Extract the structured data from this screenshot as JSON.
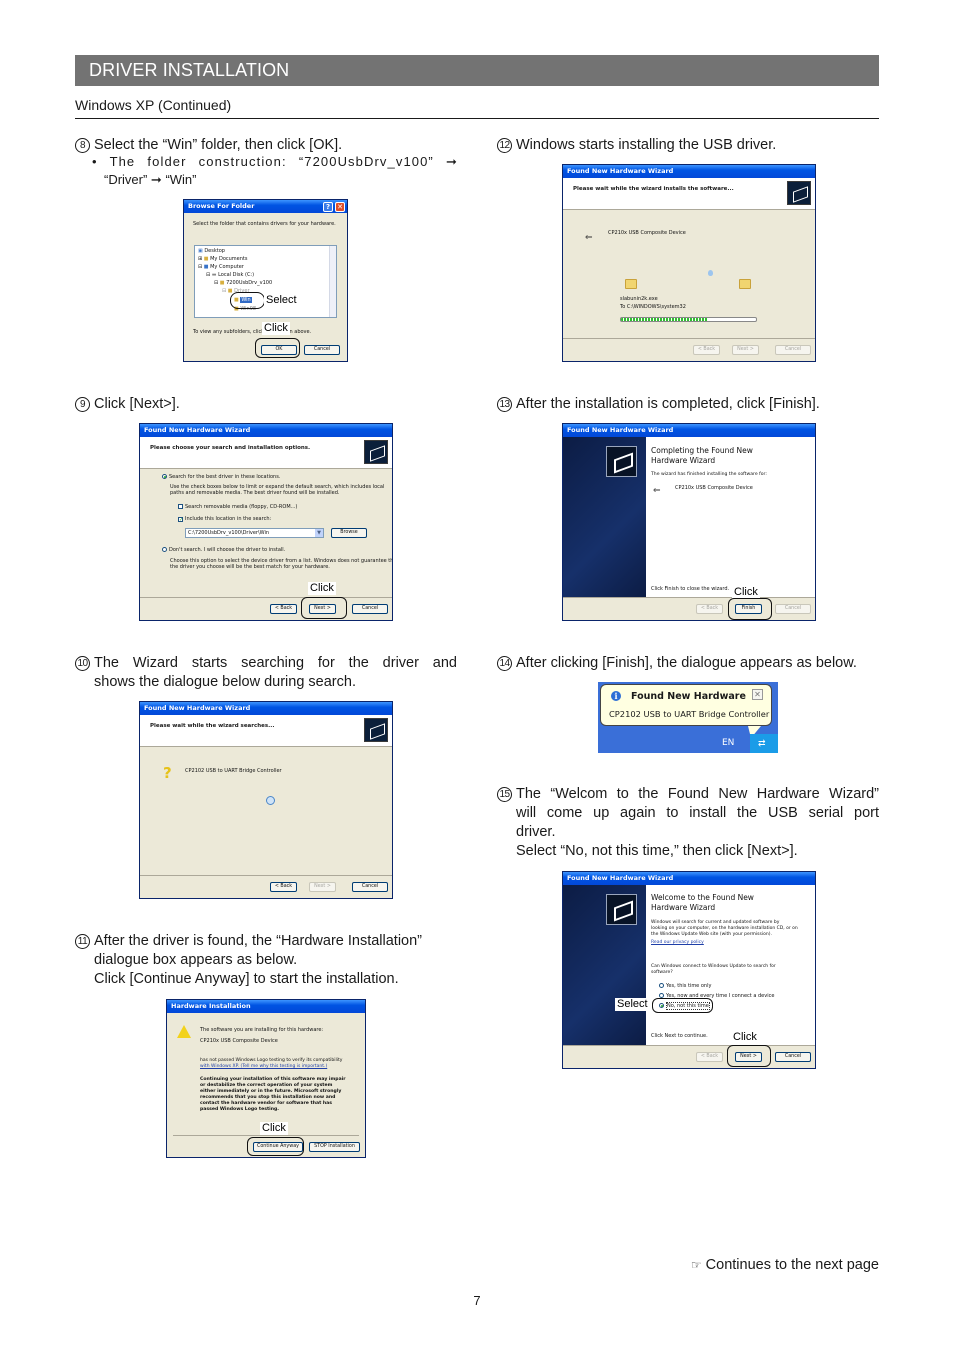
{
  "header": {
    "banner_title": "DRIVER INSTALLATION",
    "section_title": "Windows XP (Continued)"
  },
  "steps": [
    {
      "num": "8",
      "lines": [
        "Select the “Win” folder, then click [OK]."
      ],
      "bullet": [
        "• The folder construction: “7200UsbDrv_v100” ➞",
        "“Driver” ➞ “Win”"
      ],
      "dialog": {
        "title": "Browse For Folder",
        "prompt": "Select the folder that contains drivers for your hardware.",
        "tree": [
          "Desktop",
          "My Documents",
          "My Computer",
          "Local Disk (C:)",
          "7200UsbDrv_v100",
          "Driver",
          "Win",
          "Win98"
        ],
        "hint": "To view any subfolders, click a plus sign above.",
        "ok": "OK",
        "cancel": "Cancel",
        "callout_select": "Select",
        "callout_click": "Click"
      }
    },
    {
      "num": "9",
      "lines": [
        "Click [Next>]."
      ],
      "dialog": {
        "title": "Found New Hardware Wizard",
        "header": "Please choose your search and installation options.",
        "opt1": "Search for the best driver in these locations.",
        "opt1_desc": [
          "Use the check boxes below to limit or expand the default search, which includes local",
          "paths and removable media. The best driver found will be installed."
        ],
        "chk1": "Search removable media (floppy, CD-ROM...)",
        "chk2": "Include this location in the search:",
        "path": "C:\\7200UsbDrv_v100\\Driver\\Win",
        "browse": "Browse",
        "opt2": "Don't search. I will choose the driver to install.",
        "opt2_desc": [
          "Choose this option to select the device driver from a list.  Windows does not guarantee that",
          "the driver you choose will be the best match for your hardware."
        ],
        "back": "< Back",
        "next": "Next >",
        "cancel": "Cancel",
        "callout_click": "Click"
      }
    },
    {
      "num": "10",
      "lines": [
        "The Wizard starts searching for the driver and",
        "shows the dialogue below during search."
      ],
      "dialog": {
        "title": "Found New Hardware Wizard",
        "header": "Please wait while the wizard searches...",
        "device": "CP2102 USB to UART Bridge Controller",
        "back": "< Back",
        "next": "Next >",
        "cancel": "Cancel"
      }
    },
    {
      "num": "11",
      "lines": [
        "After the driver is found, the “Hardware Installation”",
        "dialogue box appears as below.",
        "Click [Continue Anyway] to start the installation."
      ],
      "dialog": {
        "title": "Hardware Installation",
        "line1": "The software you are installing for this hardware:",
        "device": "CP210x USB Composite Device",
        "line2": [
          "has not passed Windows Logo testing to verify its compatibility",
          "with Windows XP. (Tell me why this testing is important.)"
        ],
        "warning": [
          "Continuing your installation of this software may impair",
          "or destabilize the correct operation of your system",
          "either immediately or in the future. Microsoft strongly",
          "recommends that you stop this installation now and",
          "contact the hardware vendor for software that has",
          "passed Windows Logo testing."
        ],
        "continue": "Continue Anyway",
        "stop": "STOP Installation",
        "callout_click": "Click"
      }
    },
    {
      "num": "12",
      "lines": [
        "Windows starts installing the USB driver."
      ],
      "dialog": {
        "title": "Found New Hardware Wizard",
        "header": "Please wait while the wizard installs the software...",
        "device": "CP210x USB Composite Device",
        "file": "slabunin2k.exe",
        "dest": "To C:\\WINDOWS\\system32",
        "progress": 0.64,
        "back": "< Back",
        "next": "Next >",
        "cancel": "Cancel"
      }
    },
    {
      "num": "13",
      "lines": [
        "After the installation is completed, click [Finish]."
      ],
      "dialog": {
        "title": "Found New Hardware Wizard",
        "heading": [
          "Completing the Found New",
          "Hardware Wizard"
        ],
        "line1": "The wizard has finished installing the software for:",
        "device": "CP210x USB Composite Device",
        "line2": "Click Finish to close the wizard.",
        "back": "< Back",
        "finish": "Finish",
        "cancel": "Cancel",
        "callout_click": "Click"
      }
    },
    {
      "num": "14",
      "lines": [
        "After clicking [Finish], the dialogue appears as below."
      ],
      "balloon": {
        "title": "Found New Hardware",
        "body": "CP2102 USB to UART Bridge Controller",
        "tray_lang": "EN"
      }
    },
    {
      "num": "15",
      "lines": [
        "The “Welcom to the Found New Hardware Wizard”",
        "will come up again to install the USB serial port",
        "driver.",
        "Select “No, not this time,” then click [Next>]."
      ],
      "dialog": {
        "title": "Found New Hardware Wizard",
        "heading": [
          "Welcome to the Found New",
          "Hardware Wizard"
        ],
        "desc": [
          "Windows will search for current and updated software by",
          "looking on your computer, on the hardware installation CD, or on",
          "the Windows Update Web site (with your permission)."
        ],
        "privacy": "Read our privacy policy",
        "question": [
          "Can Windows connect to Windows Update to search for",
          "software?"
        ],
        "r1": "Yes, this time only",
        "r2": "Yes, now and every time I connect a device",
        "r3": "No, not this time",
        "line2": "Click Next to continue.",
        "back": "< Back",
        "next": "Next >",
        "cancel": "Cancel",
        "callout_select": "Select",
        "callout_click": "Click"
      }
    }
  ],
  "footer": {
    "continues": "Continues to the next page",
    "page_number": "7"
  }
}
